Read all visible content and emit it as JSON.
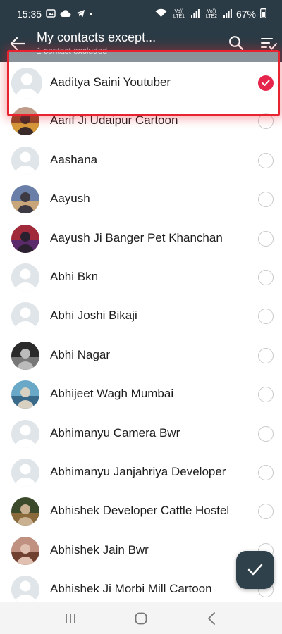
{
  "status_bar": {
    "time": "15:35",
    "network_1": "Vo)) LTE1",
    "network_2": "Vo)) LTE2",
    "battery": "67%"
  },
  "app_bar": {
    "title": "My contacts except...",
    "subtitle": "1 contact excluded"
  },
  "colors": {
    "header_bg": "#2b3b45",
    "checked": "#e5254c",
    "highlight": "#e8232f",
    "fab_bg": "#2f414b"
  },
  "contacts": [
    {
      "name": "Aaditya Saini Youtuber",
      "checked": true,
      "avatar": "default-avatar"
    },
    {
      "name": "Aarif Ji Udaipur Cartoon",
      "checked": false,
      "avatar": "photo-avatar"
    },
    {
      "name": "Aashana",
      "checked": false,
      "avatar": "default-avatar"
    },
    {
      "name": "Aayush",
      "checked": false,
      "avatar": "photo-avatar"
    },
    {
      "name": "Aayush Ji Banger Pet Khanchan",
      "checked": false,
      "avatar": "photo-avatar"
    },
    {
      "name": "Abhi Bkn",
      "checked": false,
      "avatar": "default-avatar"
    },
    {
      "name": "Abhi Joshi Bikaji",
      "checked": false,
      "avatar": "default-avatar"
    },
    {
      "name": "Abhi Nagar",
      "checked": false,
      "avatar": "photo-avatar"
    },
    {
      "name": "Abhijeet Wagh Mumbai",
      "checked": false,
      "avatar": "photo-avatar"
    },
    {
      "name": "Abhimanyu Camera Bwr",
      "checked": false,
      "avatar": "default-avatar"
    },
    {
      "name": "Abhimanyu Janjahriya Developer",
      "checked": false,
      "avatar": "default-avatar"
    },
    {
      "name": "Abhishek Developer Cattle Hostel",
      "checked": false,
      "avatar": "photo-avatar"
    },
    {
      "name": "Abhishek Jain Bwr",
      "checked": false,
      "avatar": "photo-avatar"
    },
    {
      "name": "Abhishek Ji Morbi Mill Cartoon",
      "checked": false,
      "avatar": "default-avatar"
    }
  ]
}
